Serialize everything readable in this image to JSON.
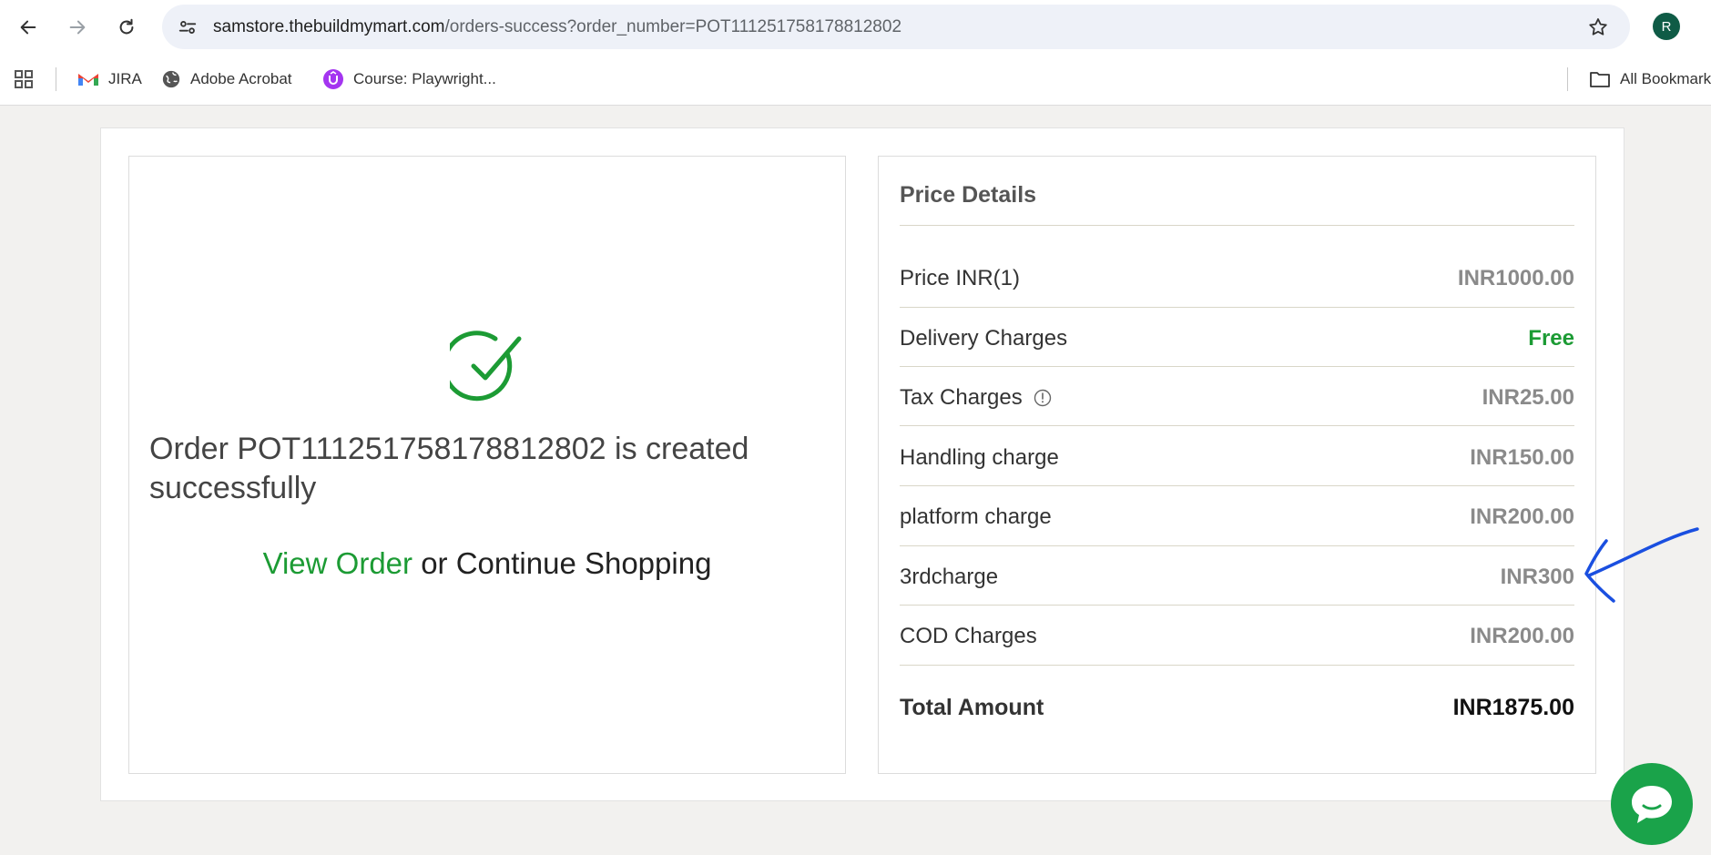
{
  "browser": {
    "url_host": "samstore.thebuildmymart.com",
    "url_path": "/orders-success?order_number=POT111251758178812802",
    "profile_initial": "R",
    "bookmarks": [
      {
        "label": "JIRA",
        "icon": "gmail-icon"
      },
      {
        "label": "Adobe Acrobat",
        "icon": "globe-icon"
      },
      {
        "label": "Course: Playwright...",
        "icon": "course-icon"
      }
    ],
    "all_bookmarks_label": "All Bookmarks"
  },
  "order": {
    "message": "Order POT111251758178812802 is created successfully",
    "view_order_label": "View Order",
    "or_text": "or",
    "continue_label": "Continue Shopping"
  },
  "price_details": {
    "title": "Price Details",
    "rows": [
      {
        "label": "Price INR(1)",
        "value": "INR1000.00"
      },
      {
        "label": "Delivery Charges",
        "value": "Free"
      },
      {
        "label": "Tax Charges",
        "value": "INR25.00"
      },
      {
        "label": "Handling charge",
        "value": "INR150.00"
      },
      {
        "label": "platform charge",
        "value": "INR200.00"
      },
      {
        "label": "3rdcharge",
        "value": "INR300"
      },
      {
        "label": "COD Charges",
        "value": "INR200.00"
      }
    ],
    "total_label": "Total Amount",
    "total_value": "INR1875.00"
  },
  "colors": {
    "success_green": "#1c9b34",
    "annotation_blue": "#1a4fe0",
    "chat_green": "#1aa34a"
  }
}
